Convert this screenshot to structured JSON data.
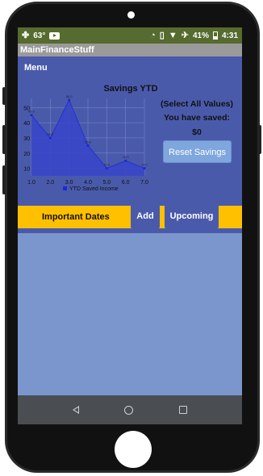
{
  "status": {
    "temperature": "63°",
    "battery_pct": "41%",
    "time": "4:31"
  },
  "app": {
    "title": "MainFinanceStuff"
  },
  "menu": {
    "label": "Menu"
  },
  "chart_title": "Savings YTD",
  "chart_data": {
    "type": "area",
    "title": "Savings YTD",
    "x": [
      1.0,
      2.0,
      3.0,
      4.0,
      5.0,
      6.0,
      7.0
    ],
    "x_tick_labels": [
      "1.0",
      "2.0",
      "3.0",
      "4.0",
      "5.0",
      "6.0",
      "7.0"
    ],
    "y_ticks": [
      10,
      20,
      30,
      40,
      50
    ],
    "ylim": [
      5,
      56
    ],
    "series": [
      {
        "name": "YTD Saved Income",
        "values": [
          45,
          30,
          55,
          25,
          10,
          15,
          10
        ],
        "value_labels": [
          "45.0",
          "30.0",
          "55.0",
          "25.0",
          "10.0",
          "15.0",
          "10.0"
        ]
      }
    ],
    "legend_position": "bottom",
    "grid": true,
    "colors": {
      "fill": "#3a46c8",
      "line": "#2233cc",
      "marker": "#1a2ad6"
    }
  },
  "savings_panel": {
    "select_all": "(Select All Values)",
    "you_have_saved": "You have saved:",
    "amount": "$0",
    "reset_button": "Reset Savings"
  },
  "dates_bar": {
    "label": "Important Dates",
    "add_button": "Add",
    "upcoming_button": "Upcoming"
  },
  "colors": {
    "status_bar": "#556b2f",
    "panel": "#4a5aab",
    "accent": "#ffc000",
    "content": "#7a96cc"
  }
}
